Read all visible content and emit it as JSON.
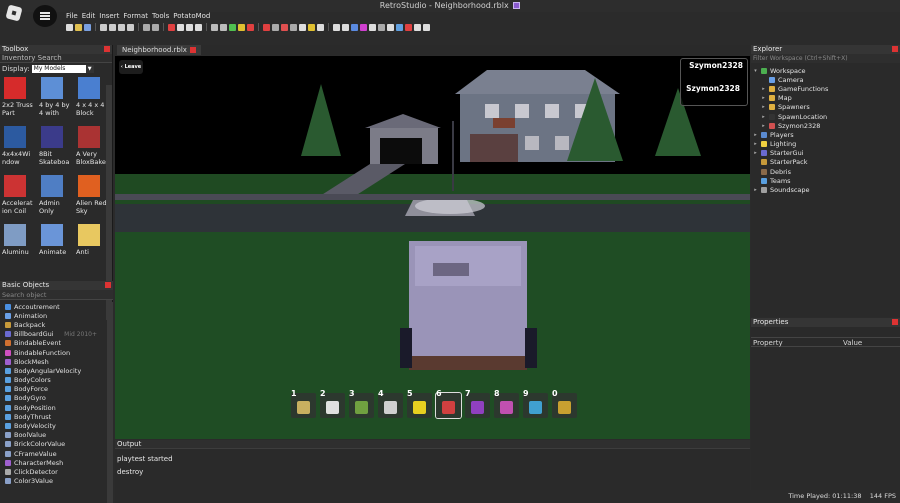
{
  "window": {
    "title": "RetroStudio - Neighborhood.rblx"
  },
  "menu": [
    "File",
    "Edit",
    "Insert",
    "Format",
    "Tools",
    "PotatoMod"
  ],
  "toolbox": {
    "header": "Toolbox",
    "inventory_search": "Inventory Search",
    "display_label": "Display:",
    "display_value": "My Models",
    "items": [
      {
        "label": "2x2 Truss Part",
        "color": "#d62b2b"
      },
      {
        "label": "4 by 4 by 4 with",
        "color": "#5d8fd6"
      },
      {
        "label": "4 x 4 x 4 Block",
        "color": "#4a7fd0"
      },
      {
        "label": "4x4x4Wi ndow",
        "color": "#2c5aa0"
      },
      {
        "label": "8Bit Skateboa",
        "color": "#3b3b8a"
      },
      {
        "label": "A Very BloxBake",
        "color": "#a33"
      },
      {
        "label": "Accelerat ion Coil",
        "color": "#c33"
      },
      {
        "label": "Admin Only",
        "color": "#4f7ec4"
      },
      {
        "label": "Alien Red Sky",
        "color": "#e06020"
      },
      {
        "label": "Aluminu",
        "color": "#7f9cc4"
      },
      {
        "label": "Animate",
        "color": "#6a95d8"
      },
      {
        "label": "Anti",
        "color": "#e8c860"
      }
    ]
  },
  "basic_objects": {
    "header": "Basic Objects",
    "search_placeholder": "Search object",
    "items": [
      {
        "label": "Accoutrement",
        "icon": "#4a90e2"
      },
      {
        "label": "Animation",
        "icon": "#6aa0e8"
      },
      {
        "label": "Backpack",
        "icon": "#c79a3a"
      },
      {
        "label": "BillboardGui",
        "icon": "#6a6ad0",
        "tag": "Mid 2010+"
      },
      {
        "label": "BindableEvent",
        "icon": "#d07030"
      },
      {
        "label": "BindableFunction",
        "icon": "#d050c0"
      },
      {
        "label": "BlockMesh",
        "icon": "#a060d0"
      },
      {
        "label": "BodyAngularVelocity",
        "icon": "#5aa0e0"
      },
      {
        "label": "BodyColors",
        "icon": "#5aa0e0"
      },
      {
        "label": "BodyForce",
        "icon": "#5aa0e0"
      },
      {
        "label": "BodyGyro",
        "icon": "#5aa0e0"
      },
      {
        "label": "BodyPosition",
        "icon": "#5aa0e0"
      },
      {
        "label": "BodyThrust",
        "icon": "#5aa0e0"
      },
      {
        "label": "BodyVelocity",
        "icon": "#5aa0e0"
      },
      {
        "label": "BoolValue",
        "icon": "#8aa0c8"
      },
      {
        "label": "BrickColorValue",
        "icon": "#8aa0c8"
      },
      {
        "label": "CFrameValue",
        "icon": "#8aa0c8"
      },
      {
        "label": "CharacterMesh",
        "icon": "#a060d0"
      },
      {
        "label": "ClickDetector",
        "icon": "#aaaaaa"
      },
      {
        "label": "Color3Value",
        "icon": "#8aa0c8"
      }
    ]
  },
  "viewport": {
    "tab": "Neighborhood.rblx",
    "leave_label": "Leave",
    "player_list_name": "Szymon2328",
    "overhead_name": "Szymon2328",
    "hotbar": [
      {
        "num": "1",
        "color": "#c8b060"
      },
      {
        "num": "2",
        "color": "#e0e0e0"
      },
      {
        "num": "3",
        "color": "#70a040"
      },
      {
        "num": "4",
        "color": "#d0d0d0"
      },
      {
        "num": "5",
        "color": "#e8d020"
      },
      {
        "num": "6",
        "color": "#d04040",
        "selected": true
      },
      {
        "num": "7",
        "color": "#9040c0"
      },
      {
        "num": "8",
        "color": "#c050b0"
      },
      {
        "num": "9",
        "color": "#40a0d0"
      },
      {
        "num": "0",
        "color": "#c8a030"
      }
    ]
  },
  "output": {
    "header": "Output",
    "lines": [
      "playtest started",
      "destroy"
    ]
  },
  "explorer": {
    "header": "Explorer",
    "filter_placeholder": "Filter Workspace (Ctrl+Shift+X)",
    "items": [
      {
        "label": "Workspace",
        "depth": 0,
        "chev": "▾",
        "icon": "#4caf50"
      },
      {
        "label": "Camera",
        "depth": 1,
        "chev": "",
        "icon": "#6aa0e8"
      },
      {
        "label": "GameFunctions",
        "depth": 1,
        "chev": "▸",
        "icon": "#e0b040"
      },
      {
        "label": "Map",
        "depth": 1,
        "chev": "▸",
        "icon": "#e0b040"
      },
      {
        "label": "Spawners",
        "depth": 1,
        "chev": "▸",
        "icon": "#e0b040"
      },
      {
        "label": "SpawnLocation",
        "depth": 1,
        "chev": "▸",
        "icon": "#333333"
      },
      {
        "label": "Szymon2328",
        "depth": 1,
        "chev": "▸",
        "icon": "#d05050"
      },
      {
        "label": "Players",
        "depth": 0,
        "chev": "▸",
        "icon": "#5a8ad0"
      },
      {
        "label": "Lighting",
        "depth": 0,
        "chev": "▸",
        "icon": "#f0d040"
      },
      {
        "label": "StarterGui",
        "depth": 0,
        "chev": "▸",
        "icon": "#6a6ad0"
      },
      {
        "label": "StarterPack",
        "depth": 0,
        "chev": "",
        "icon": "#c79a3a"
      },
      {
        "label": "Debris",
        "depth": 0,
        "chev": "",
        "icon": "#8a6a4a"
      },
      {
        "label": "Teams",
        "depth": 0,
        "chev": "",
        "icon": "#5aa0e0"
      },
      {
        "label": "Soundscape",
        "depth": 0,
        "chev": "▸",
        "icon": "#a0a0a0"
      }
    ]
  },
  "properties": {
    "header": "Properties",
    "col_property": "Property",
    "col_value": "Value"
  },
  "status": {
    "time_played": "Time Played: 01:11:38",
    "fps": "144 FPS"
  }
}
